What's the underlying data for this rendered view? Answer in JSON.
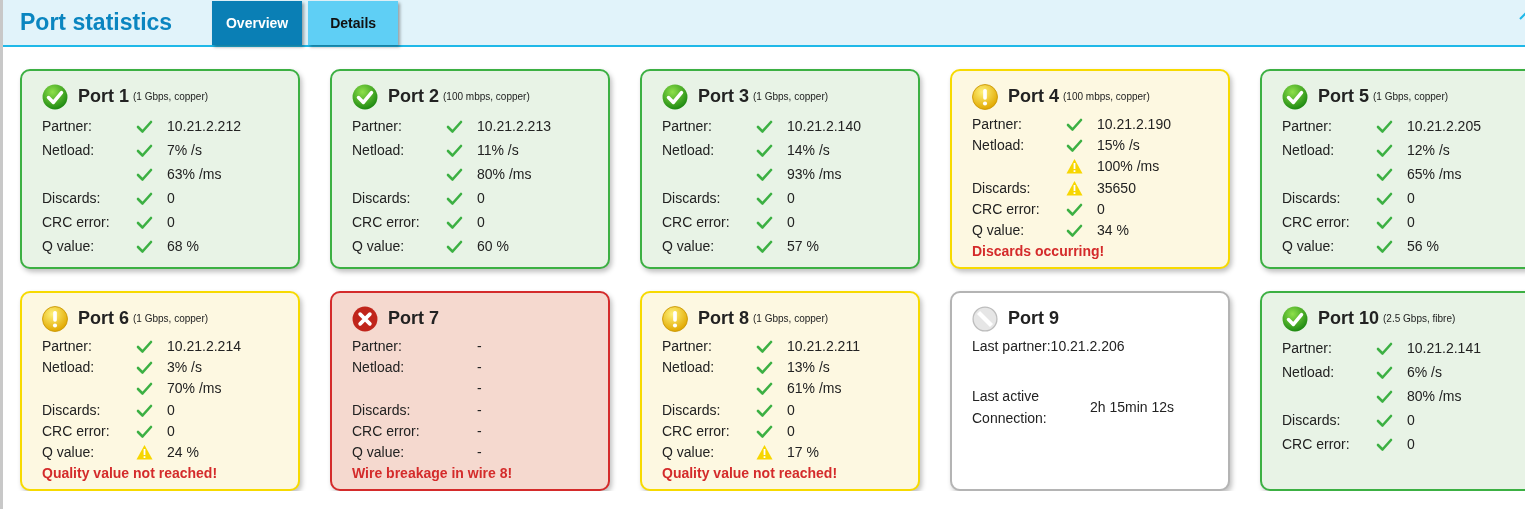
{
  "header": {
    "title": "Port statistics",
    "tabs": [
      {
        "label": "Overview",
        "selected": true
      },
      {
        "label": "Details",
        "selected": false
      }
    ]
  },
  "ports": [
    {
      "title": "Port 1",
      "detail": "(1 Gbps, copper)",
      "kind": "ok",
      "rows": [
        {
          "label": "Partner:",
          "kind": "ok",
          "value": "10.21.2.212"
        },
        {
          "label": "Netload:",
          "kind": "ok",
          "value": "7% /s"
        },
        {
          "kind": "ok",
          "value": "63% /ms"
        },
        {
          "label": "Discards:",
          "kind": "ok",
          "value": "0"
        },
        {
          "label": "CRC error:",
          "kind": "ok",
          "value": "0"
        },
        {
          "label": "Q value:",
          "kind": "ok",
          "value": "68 %"
        }
      ]
    },
    {
      "title": "Port 2",
      "detail": "(100 mbps, copper)",
      "kind": "ok",
      "rows": [
        {
          "label": "Partner:",
          "kind": "ok",
          "value": "10.21.2.213"
        },
        {
          "label": "Netload:",
          "kind": "ok",
          "value": "11% /s"
        },
        {
          "kind": "ok",
          "value": "80% /ms"
        },
        {
          "label": "Discards:",
          "kind": "ok",
          "value": "0"
        },
        {
          "label": "CRC error:",
          "kind": "ok",
          "value": "0"
        },
        {
          "label": "Q value:",
          "kind": "ok",
          "value": "60 %"
        }
      ]
    },
    {
      "title": "Port 3",
      "detail": "(1 Gbps, copper)",
      "kind": "ok",
      "rows": [
        {
          "label": "Partner:",
          "kind": "ok",
          "value": "10.21.2.140"
        },
        {
          "label": "Netload:",
          "kind": "ok",
          "value": "14% /s"
        },
        {
          "kind": "ok",
          "value": "93% /ms"
        },
        {
          "label": "Discards:",
          "kind": "ok",
          "value": "0"
        },
        {
          "label": "CRC error:",
          "kind": "ok",
          "value": "0"
        },
        {
          "label": "Q value:",
          "kind": "ok",
          "value": "57 %"
        }
      ]
    },
    {
      "title": "Port 4",
      "detail": "(100 mbps, copper)",
      "kind": "warn",
      "rows": [
        {
          "label": "Partner:",
          "kind": "ok",
          "value": "10.21.2.190"
        },
        {
          "label": "Netload:",
          "kind": "ok",
          "value": "15% /s"
        },
        {
          "kind": "warn",
          "value": "100% /ms"
        },
        {
          "label": "Discards:",
          "kind": "warn",
          "value": "35650"
        },
        {
          "label": "CRC error:",
          "kind": "ok",
          "value": "0"
        },
        {
          "label": "Q value:",
          "kind": "ok",
          "value": "34 %"
        }
      ],
      "message": "Discards occurring!"
    },
    {
      "title": "Port 5",
      "detail": "(1 Gbps, copper)",
      "kind": "ok",
      "rows": [
        {
          "label": "Partner:",
          "kind": "ok",
          "value": "10.21.2.205"
        },
        {
          "label": "Netload:",
          "kind": "ok",
          "value": "12% /s"
        },
        {
          "kind": "ok",
          "value": "65% /ms"
        },
        {
          "label": "Discards:",
          "kind": "ok",
          "value": "0"
        },
        {
          "label": "CRC error:",
          "kind": "ok",
          "value": "0"
        },
        {
          "label": "Q value:",
          "kind": "ok",
          "value": "56 %"
        }
      ]
    },
    {
      "title": "Port 6",
      "detail": "(1 Gbps, copper)",
      "kind": "warn",
      "rows": [
        {
          "label": "Partner:",
          "kind": "ok",
          "value": "10.21.2.214"
        },
        {
          "label": "Netload:",
          "kind": "ok",
          "value": "3% /s"
        },
        {
          "kind": "ok",
          "value": "70% /ms"
        },
        {
          "label": "Discards:",
          "kind": "ok",
          "value": "0"
        },
        {
          "label": "CRC error:",
          "kind": "ok",
          "value": "0"
        },
        {
          "label": "Q value:",
          "kind": "warn",
          "value": "24 %"
        }
      ],
      "message": "Quality value not reached!"
    },
    {
      "title": "Port 7",
      "kind": "error",
      "rows": [
        {
          "label": "Partner:",
          "kind": "blank",
          "value": "-"
        },
        {
          "label": "Netload:",
          "kind": "blank",
          "value": "-"
        },
        {
          "kind": "blank",
          "value": "-"
        },
        {
          "label": "Discards:",
          "kind": "blank",
          "value": "-"
        },
        {
          "label": "CRC error:",
          "kind": "blank",
          "value": "-"
        },
        {
          "label": "Q value:",
          "kind": "blank",
          "value": "-"
        }
      ],
      "message": "Wire breakage in wire 8!"
    },
    {
      "title": "Port 8",
      "detail": "(1 Gbps, copper)",
      "kind": "warn",
      "rows": [
        {
          "label": "Partner:",
          "kind": "ok",
          "value": "10.21.2.211"
        },
        {
          "label": "Netload:",
          "kind": "ok",
          "value": "13% /s"
        },
        {
          "kind": "ok",
          "value": "61% /ms"
        },
        {
          "label": "Discards:",
          "kind": "ok",
          "value": "0"
        },
        {
          "label": "CRC error:",
          "kind": "ok",
          "value": "0"
        },
        {
          "label": "Q value:",
          "kind": "warn",
          "value": "17 %"
        }
      ],
      "message": "Quality value not reached!"
    },
    {
      "title": "Port 9",
      "kind": "inactive",
      "rows": [
        {
          "label": "Last partner:",
          "kind": "history",
          "value": "10.21.2.206"
        },
        {
          "label": "Last active Connection:",
          "kind": "history",
          "value": "2h 15min 12s"
        }
      ]
    },
    {
      "title": "Port 10",
      "detail": "(2.5 Gbps, fibre)",
      "kind": "ok",
      "rows": [
        {
          "label": "Partner:",
          "kind": "ok",
          "value": "10.21.2.141"
        },
        {
          "label": "Netload:",
          "kind": "ok",
          "value": "6% /s"
        },
        {
          "kind": "ok",
          "value": "80% /ms"
        },
        {
          "label": "Discards:",
          "kind": "ok",
          "value": "0"
        },
        {
          "label": "CRC error:",
          "kind": "ok",
          "value": "0"
        }
      ]
    }
  ]
}
